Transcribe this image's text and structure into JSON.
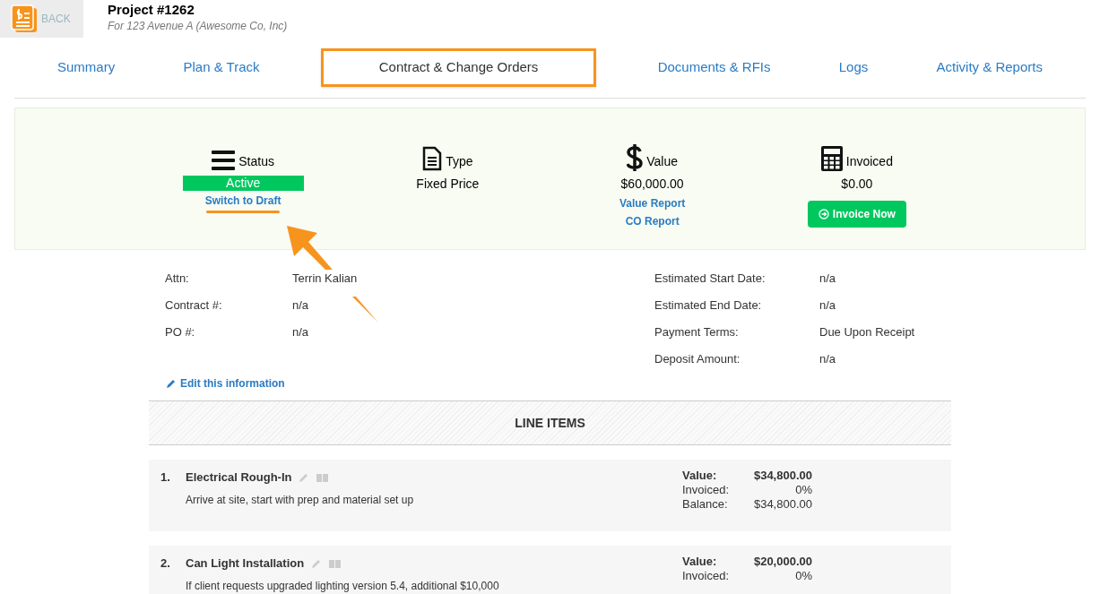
{
  "header": {
    "back": "BACK",
    "title": "Project #1262",
    "subtitle": "For 123 Avenue A (Awesome Co, Inc)"
  },
  "tabs": [
    {
      "label": "Summary",
      "selected": false
    },
    {
      "label": "Plan & Track",
      "selected": false
    },
    {
      "label": "Contract & Change Orders",
      "selected": true
    },
    {
      "label": "Documents & RFIs",
      "selected": false
    },
    {
      "label": "Logs",
      "selected": false
    },
    {
      "label": "Activity & Reports",
      "selected": false
    }
  ],
  "summary": [
    {
      "kind": "status",
      "label": "Status",
      "badge": "Active",
      "links": [
        "Switch to Draft"
      ]
    },
    {
      "kind": "type",
      "label": "Type",
      "value": "Fixed Price"
    },
    {
      "kind": "value",
      "label": "Value",
      "value": "$60,000.00",
      "links": [
        "Value Report",
        "CO Report"
      ]
    },
    {
      "kind": "invoiced",
      "label": "Invoiced",
      "value": "$0.00",
      "button": "Invoice Now"
    }
  ],
  "details_left": [
    {
      "label": "Attn:",
      "value": "Terrin Kalian"
    },
    {
      "label": "Contract #:",
      "value": "n/a"
    },
    {
      "label": "PO #:",
      "value": "n/a"
    }
  ],
  "details_right": [
    {
      "label": "Estimated Start Date:",
      "value": "n/a"
    },
    {
      "label": "Estimated End Date:",
      "value": "n/a"
    },
    {
      "label": "Payment Terms:",
      "value": "Due Upon Receipt"
    },
    {
      "label": "Deposit Amount:",
      "value": "n/a"
    }
  ],
  "edit_link": "Edit this information",
  "line_items": {
    "title": "LINE ITEMS",
    "items": [
      {
        "number": "1.",
        "name": "Electrical Rough-In",
        "description": "Arrive at site, start with prep and material set up",
        "amounts": [
          {
            "label": "Value:",
            "value": "$34,800.00"
          },
          {
            "label": "Invoiced:",
            "value": "0%"
          },
          {
            "label": "Balance:",
            "value": "$34,800.00"
          }
        ]
      },
      {
        "number": "2.",
        "name": "Can Light Installation",
        "description": "If client requests upgraded lighting version 5.4, additional $10,000",
        "amounts": [
          {
            "label": "Value:",
            "value": "$20,000.00"
          },
          {
            "label": "Invoiced:",
            "value": "0%"
          }
        ]
      }
    ]
  }
}
